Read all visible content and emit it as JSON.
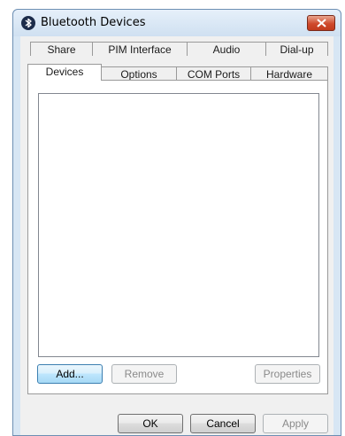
{
  "window": {
    "title": "Bluetooth Devices"
  },
  "tabs": {
    "back_row": [
      "Share",
      "PIM Interface",
      "Audio",
      "Dial-up"
    ],
    "front_row": [
      "Devices",
      "Options",
      "COM Ports",
      "Hardware"
    ],
    "selected": "Devices"
  },
  "device_panel": {
    "add_label": "Add...",
    "remove_label": "Remove",
    "properties_label": "Properties"
  },
  "footer": {
    "ok_label": "OK",
    "cancel_label": "Cancel",
    "apply_label": "Apply"
  }
}
